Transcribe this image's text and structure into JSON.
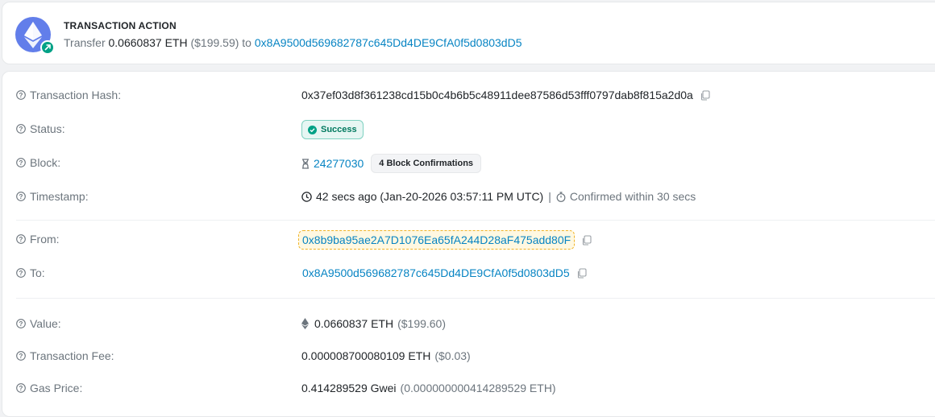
{
  "header": {
    "title": "TRANSACTION ACTION",
    "action_verb": "Transfer",
    "amount": "0.0660837 ETH",
    "amount_usd": "($199.59)",
    "to_word": "to",
    "to_address": "0x8A9500d569682787c645Dd4DE9CfA0f5d0803dD5"
  },
  "details": {
    "tx_hash": {
      "label": "Transaction Hash:",
      "value": "0x37ef03d8f361238cd15b0c4b6b5c48911dee87586d53fff0797dab8f815a2d0a"
    },
    "status": {
      "label": "Status:",
      "value": "Success"
    },
    "block": {
      "label": "Block:",
      "number": "24277030",
      "confirmations": "4 Block Confirmations"
    },
    "timestamp": {
      "label": "Timestamp:",
      "value": "42 secs ago (Jan-20-2026 03:57:11 PM UTC)",
      "separator": "|",
      "confirmed": "Confirmed within 30 secs"
    },
    "from": {
      "label": "From:",
      "value": "0x8b9ba95ae2A7D1076Ea65fA244D28aF475add80F"
    },
    "to": {
      "label": "To:",
      "value": "0x8A9500d569682787c645Dd4DE9CfA0f5d0803dD5"
    },
    "value": {
      "label": "Value:",
      "amount": "0.0660837 ETH",
      "usd": "($199.60)"
    },
    "fee": {
      "label": "Transaction Fee:",
      "amount": "0.000008700080109 ETH",
      "usd": "($0.03)"
    },
    "gas_price": {
      "label": "Gas Price:",
      "amount": "0.414289529 Gwei",
      "eth": "(0.000000000414289529 ETH)"
    }
  },
  "colors": {
    "link": "#0784c3",
    "success": "#00a186",
    "eth_brand": "#627eea",
    "highlight": "#f0b429"
  }
}
